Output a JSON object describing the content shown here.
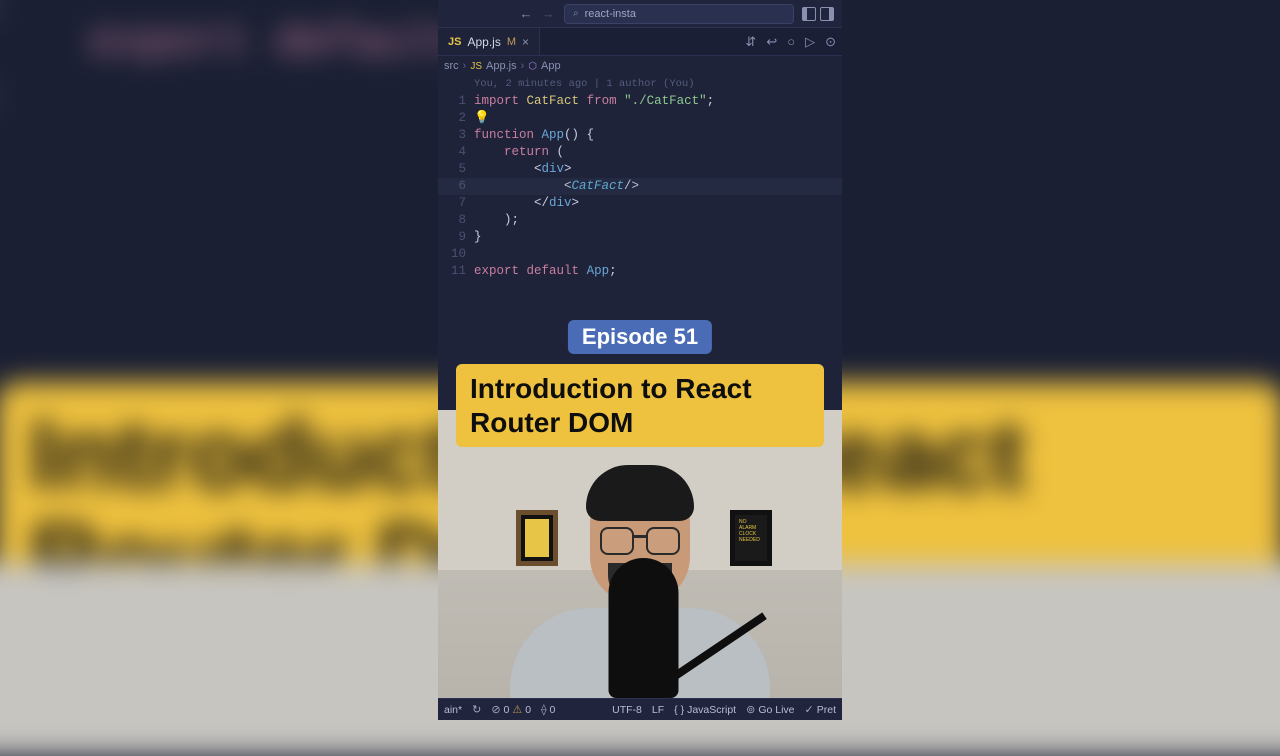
{
  "bg": {
    "line10": "10",
    "line11": "11",
    "code": "export default",
    "banner": "Introduction to React Router DOM"
  },
  "titlebar": {
    "search_text": "react-insta"
  },
  "tab": {
    "filename": "App.js",
    "modified_mark": "M"
  },
  "breadcrumb": {
    "folder": "src",
    "file": "App.js",
    "symbol": "App"
  },
  "editor": {
    "blame": "You, 2 minutes ago | 1 author (You)",
    "lines": [
      "1",
      "2",
      "3",
      "4",
      "5",
      "6",
      "7",
      "8",
      "9",
      "10",
      "11"
    ],
    "l1_import": "import",
    "l1_ident": "CatFact",
    "l1_from": "from",
    "l1_str": "\"./CatFact\"",
    "l1_semi": ";",
    "l2_bulb": "💡",
    "l3_kw": "function",
    "l3_name": "App",
    "l3_rest": "() {",
    "l4_kw": "return",
    "l4_paren": " (",
    "l5_open": "<",
    "l5_div": "div",
    "l5_close": ">",
    "l6_open": "<",
    "l6_comp": "CatFact",
    "l6_close": "/>",
    "l7_open": "</",
    "l7_div": "div",
    "l7_close": ">",
    "l8": ");",
    "l9": "}",
    "l11_export": "export",
    "l11_default": "default",
    "l11_ident": "App",
    "l11_semi": ";"
  },
  "overlay": {
    "episode": "Episode 51",
    "title": "Introduction to React Router DOM"
  },
  "statusbar": {
    "branch": "ain*",
    "sync": "↻",
    "errors": "0",
    "warnings": "0",
    "ports": "0",
    "encoding": "UTF-8",
    "eol": "LF",
    "lang": "JavaScript",
    "golive": "Go Live",
    "prettier": "Pret"
  }
}
